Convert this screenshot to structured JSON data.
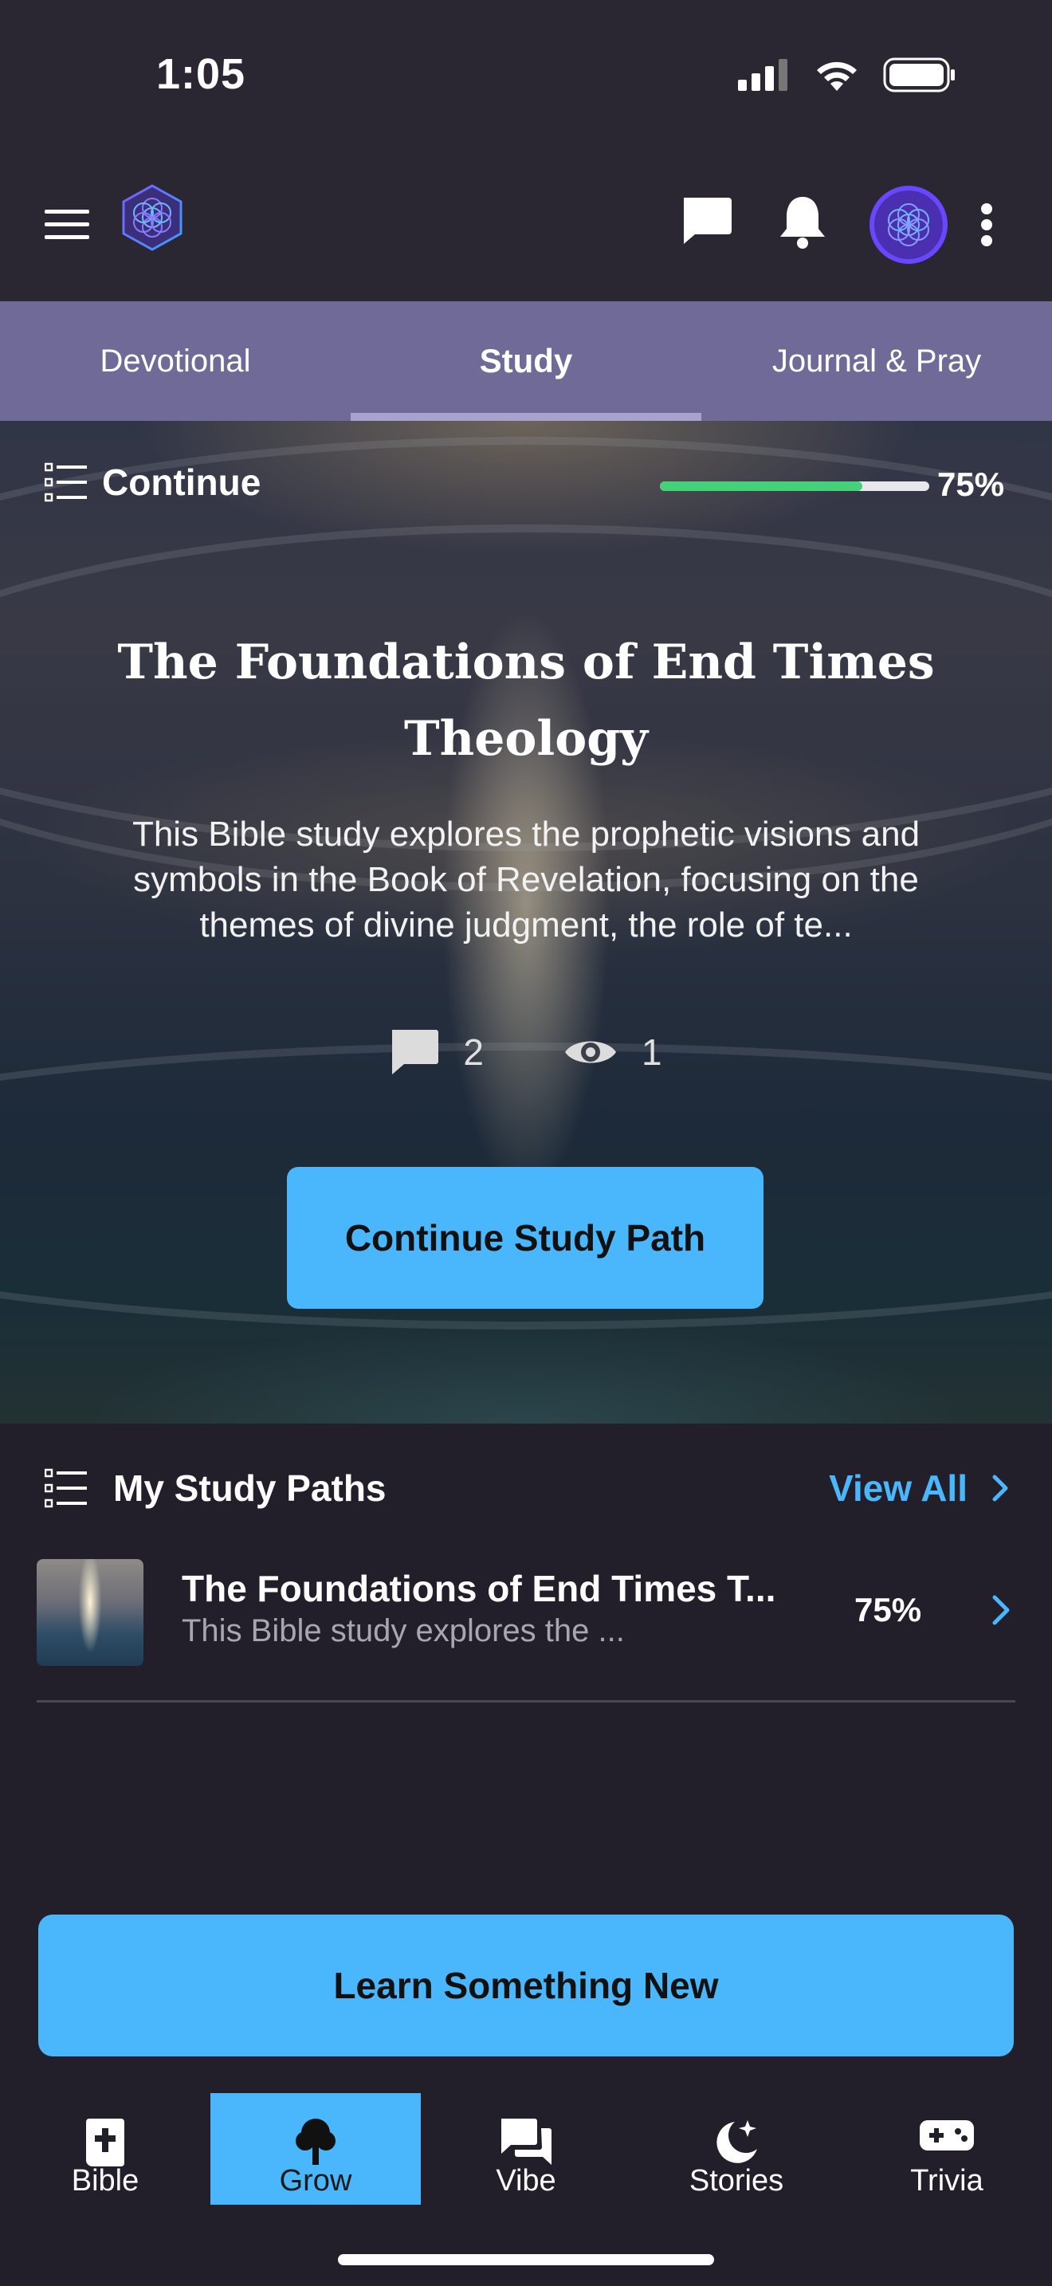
{
  "status_bar": {
    "time": "1:05"
  },
  "header": {
    "menu_icon": "hamburger-icon",
    "logo_icon": "flower-of-life-logo",
    "chat_icon": "chat-bubble-icon",
    "bell_icon": "bell-icon",
    "avatar_icon": "avatar",
    "more_icon": "more-vertical-icon"
  },
  "tabs": [
    {
      "label": "Devotional",
      "active": false
    },
    {
      "label": "Study",
      "active": true
    },
    {
      "label": "Journal & Pray",
      "active": false
    }
  ],
  "hero": {
    "continue_label": "Continue",
    "progress": 0.75,
    "progress_text": "75%",
    "title": "The Foundations of End Times Theology",
    "description": "This Bible study explores the prophetic visions and symbols in the Book of Revelation, focusing on the themes of divine judgment, the role of te...",
    "comments_count": "2",
    "views_count": "1",
    "cta_label": "Continue Study Path"
  },
  "study_paths": {
    "section_title": "My Study Paths",
    "view_all_label": "View All",
    "items": [
      {
        "title": "The Foundations of End Times T...",
        "subtitle": "This Bible study explores the ...",
        "progress_text": "75%"
      }
    ]
  },
  "learn_button_label": "Learn Something New",
  "colors": {
    "accent": "#4ab6fb",
    "tab_bar": "#6f6a98",
    "progress_green": "#43d17a",
    "background": "#221f2b"
  },
  "bottom_nav": [
    {
      "label": "Bible",
      "icon": "bible-icon",
      "active": false
    },
    {
      "label": "Grow",
      "icon": "tree-icon",
      "active": true
    },
    {
      "label": "Vibe",
      "icon": "chat-bubbles-icon",
      "active": false
    },
    {
      "label": "Stories",
      "icon": "moon-stars-icon",
      "active": false
    },
    {
      "label": "Trivia",
      "icon": "gamepad-icon",
      "active": false
    }
  ]
}
